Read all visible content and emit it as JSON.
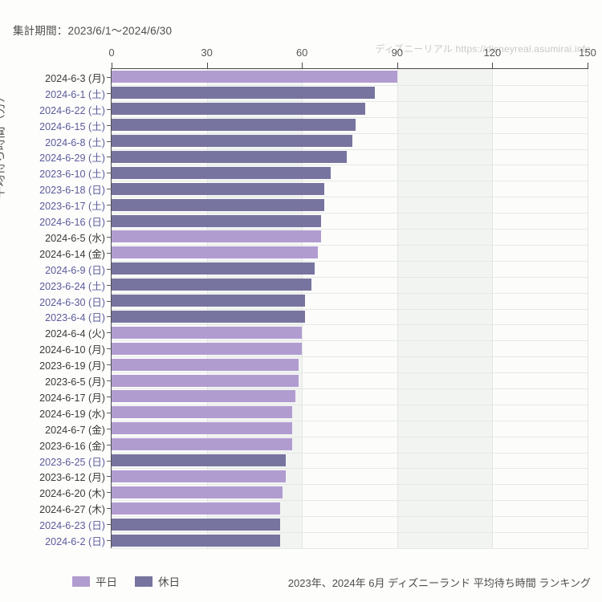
{
  "header": {
    "period_label": "集計期間：2023/6/1〜2024/6/30",
    "watermark": "ディズニーリアル https://disneyreal.asumirai.info"
  },
  "legend": {
    "items": [
      {
        "label": "平日",
        "color": "#b19cd0",
        "key": "weekday"
      },
      {
        "label": "休日",
        "color": "#77749f",
        "key": "holiday"
      }
    ]
  },
  "footer": {
    "title": "2023年、2024年 6月 ディズニーランド 平均待ち時間 ランキング"
  },
  "colors": {
    "weekday_bar": "#b19cd0",
    "holiday_bar": "#77749f",
    "weekday_label": "#3a3a3a",
    "holiday_label": "#5b5b9e",
    "band": "#f2f4f2",
    "plot_bg": "#fcfdfb",
    "axis": "#4a4a4a"
  },
  "chart_data": {
    "type": "bar",
    "orientation": "horizontal",
    "title": "2023年、2024年 6月 ディズニーランド 平均待ち時間 ランキング",
    "subtitle": "集計期間：2023/6/1〜2024/6/30",
    "xlabel": "",
    "ylabel": "平均待ち時間（分）",
    "xlim": [
      0,
      150
    ],
    "xticks": [
      0,
      30,
      60,
      90,
      120,
      150
    ],
    "xtick_labels": [
      "0",
      "30",
      "60",
      "90",
      "120",
      "150"
    ],
    "grid": true,
    "legend_position": "bottom-left",
    "categories": [
      "2024-6-3 (月)",
      "2024-6-1 (土)",
      "2024-6-22 (土)",
      "2024-6-15 (土)",
      "2024-6-8 (土)",
      "2024-6-29 (土)",
      "2023-6-10 (土)",
      "2023-6-18 (日)",
      "2023-6-17 (土)",
      "2024-6-16 (日)",
      "2024-6-5 (水)",
      "2024-6-14 (金)",
      "2024-6-9 (日)",
      "2023-6-24 (土)",
      "2024-6-30 (日)",
      "2023-6-4 (日)",
      "2024-6-4 (火)",
      "2024-6-10 (月)",
      "2023-6-19 (月)",
      "2023-6-5 (月)",
      "2024-6-17 (月)",
      "2024-6-19 (水)",
      "2024-6-7 (金)",
      "2023-6-16 (金)",
      "2023-6-25 (日)",
      "2023-6-12 (月)",
      "2024-6-20 (木)",
      "2024-6-27 (木)",
      "2024-6-23 (日)",
      "2024-6-2 (日)"
    ],
    "values": [
      90,
      83,
      80,
      77,
      76,
      74,
      69,
      67,
      67,
      66,
      66,
      65,
      64,
      63,
      61,
      61,
      60,
      60,
      59,
      59,
      58,
      57,
      57,
      57,
      55,
      55,
      54,
      53,
      53,
      53
    ],
    "day_types": [
      "weekday",
      "holiday",
      "holiday",
      "holiday",
      "holiday",
      "holiday",
      "holiday",
      "holiday",
      "holiday",
      "holiday",
      "weekday",
      "weekday",
      "holiday",
      "holiday",
      "holiday",
      "holiday",
      "weekday",
      "weekday",
      "weekday",
      "weekday",
      "weekday",
      "weekday",
      "weekday",
      "weekday",
      "holiday",
      "weekday",
      "weekday",
      "weekday",
      "holiday",
      "holiday"
    ]
  }
}
